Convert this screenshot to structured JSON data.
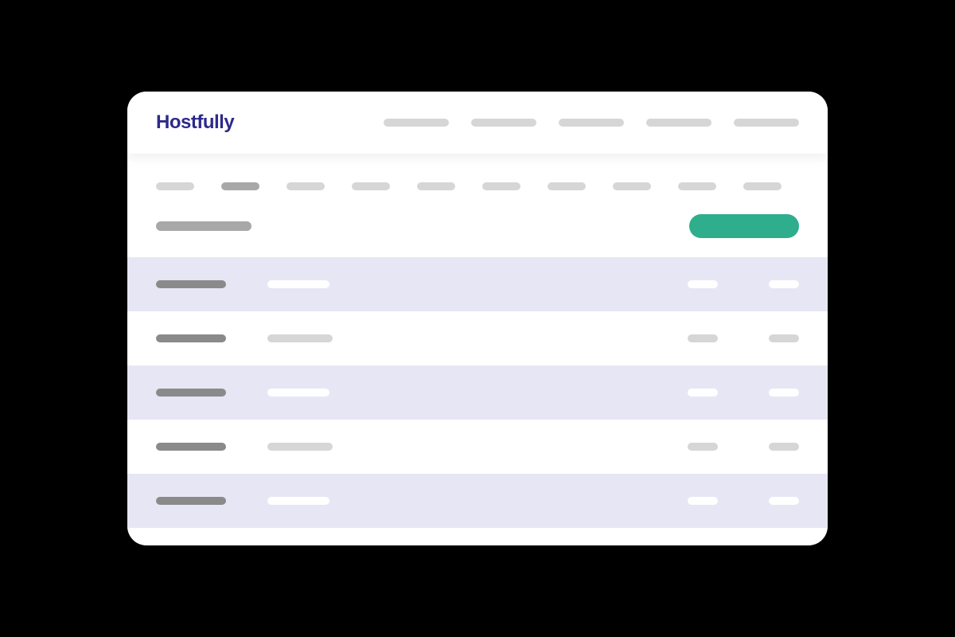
{
  "brand": {
    "name": "Hostfully",
    "color": "#2d2a8a",
    "accent": "#2eae8c"
  },
  "nav": {
    "items": [
      "",
      "",
      "",
      "",
      ""
    ]
  },
  "tabs": {
    "items": [
      "",
      "",
      "",
      "",
      "",
      "",
      "",
      "",
      "",
      ""
    ],
    "active_index": 1
  },
  "title": "",
  "primary_button": "",
  "rows": [
    {
      "alt": true,
      "col1": "",
      "col2": "",
      "col3": "",
      "col4": ""
    },
    {
      "alt": false,
      "col1": "",
      "col2": "",
      "col3": "",
      "col4": ""
    },
    {
      "alt": true,
      "col1": "",
      "col2": "",
      "col3": "",
      "col4": ""
    },
    {
      "alt": false,
      "col1": "",
      "col2": "",
      "col3": "",
      "col4": ""
    },
    {
      "alt": true,
      "col1": "",
      "col2": "",
      "col3": "",
      "col4": ""
    }
  ]
}
